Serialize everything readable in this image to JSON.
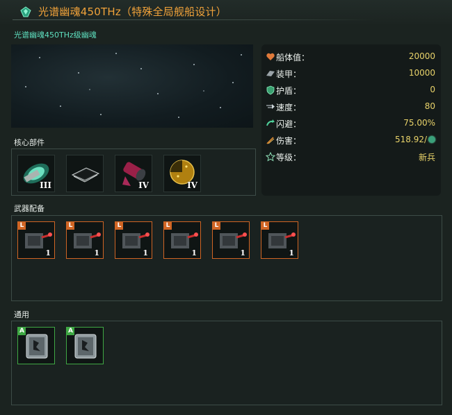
{
  "window": {
    "title": "光谱幽魂450THz（特殊全局舰船设计）",
    "subtitle": "光谱幽魂450THz级幽魂"
  },
  "sections": {
    "core": "核心部件",
    "weapons": "武器配备",
    "general": "通用"
  },
  "core_slots": [
    {
      "icon": "thruster-icon",
      "tier": "III"
    },
    {
      "icon": "chip-icon",
      "tier": ""
    },
    {
      "icon": "engine-icon",
      "tier": "IV"
    },
    {
      "icon": "radar-icon",
      "tier": "IV"
    }
  ],
  "weapon_slots": [
    {
      "size": "L",
      "icon": "turret-icon",
      "tier": "1"
    },
    {
      "size": "L",
      "icon": "turret-icon",
      "tier": "1"
    },
    {
      "size": "L",
      "icon": "turret-icon",
      "tier": "1"
    },
    {
      "size": "L",
      "icon": "turret-icon",
      "tier": "1"
    },
    {
      "size": "L",
      "icon": "turret-icon",
      "tier": "1"
    },
    {
      "size": "L",
      "icon": "turret-icon",
      "tier": "1"
    }
  ],
  "general_slots": [
    {
      "size": "A",
      "icon": "armor-module-icon"
    },
    {
      "size": "A",
      "icon": "armor-module-icon"
    }
  ],
  "stats": [
    {
      "icon": "heart-icon",
      "label": "船体值：",
      "value": "20000"
    },
    {
      "icon": "armor-plate-icon",
      "label": "装甲：",
      "value": "10000"
    },
    {
      "icon": "shield-icon",
      "label": "护盾：",
      "value": "0"
    },
    {
      "icon": "speed-icon",
      "label": "速度：",
      "value": "80"
    },
    {
      "icon": "evasion-icon",
      "label": "闪避：",
      "value": "75.00%"
    },
    {
      "icon": "damage-icon",
      "label": "伤害：",
      "value": "518.92/"
    },
    {
      "icon": "star-icon",
      "label": "等级：",
      "value": "新兵"
    }
  ],
  "colors": {
    "title": "#f0a23a",
    "subtitle": "#5fe0c0",
    "stat_value": "#e9d36a",
    "weapon_border": "#d06524",
    "general_border": "#3fa844"
  }
}
